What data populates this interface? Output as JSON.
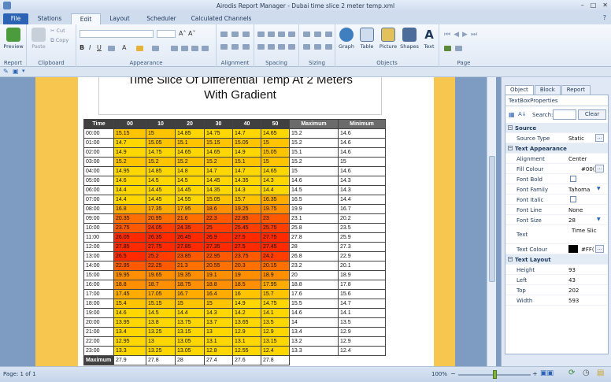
{
  "window": {
    "title": "Airodis Report Manager - Dubai time slice 2 meter temp.xml"
  },
  "menu_tabs": [
    "File",
    "Stations",
    "Edit",
    "Layout",
    "Scheduler",
    "Calculated Channels"
  ],
  "ribbon": {
    "report": {
      "label": "Report",
      "preview": "Preview"
    },
    "clipboard": {
      "label": "Clipboard",
      "paste": "Paste",
      "cut": "Cut",
      "copy": "Copy"
    },
    "appearance": {
      "label": "Appearance"
    },
    "alignment": {
      "label": "Alignment"
    },
    "spacing": {
      "label": "Spacing"
    },
    "sizing": {
      "label": "Sizing"
    },
    "objects": {
      "label": "Objects",
      "graph": "Graph",
      "table": "Table",
      "picture": "Picture",
      "shapes": "Shapes",
      "text": "Text"
    },
    "page": {
      "label": "Page"
    }
  },
  "report": {
    "title_line1": "Time Slice Of Differential Temp At 2 Meters",
    "title_line2": "With Gradient",
    "headers": [
      "Time",
      "00",
      "10",
      "20",
      "30",
      "40",
      "50",
      "Maximum",
      "Minimum"
    ],
    "rows": [
      {
        "t": "00:00",
        "v": [
          "15.15",
          "15",
          "14.85",
          "14.75",
          "14.7",
          "14.65"
        ],
        "max": "15.2",
        "min": "14.6"
      },
      {
        "t": "01:00",
        "v": [
          "14.7",
          "15.05",
          "15.1",
          "15.15",
          "15.05",
          "15"
        ],
        "max": "15.2",
        "min": "14.6"
      },
      {
        "t": "02:00",
        "v": [
          "14.9",
          "14.75",
          "14.65",
          "14.65",
          "14.9",
          "15.05"
        ],
        "max": "15.1",
        "min": "14.6"
      },
      {
        "t": "03:00",
        "v": [
          "15.2",
          "15.2",
          "15.2",
          "15.2",
          "15.1",
          "15"
        ],
        "max": "15.2",
        "min": "15"
      },
      {
        "t": "04:00",
        "v": [
          "14.95",
          "14.85",
          "14.8",
          "14.7",
          "14.7",
          "14.65"
        ],
        "max": "15",
        "min": "14.6"
      },
      {
        "t": "05:00",
        "v": [
          "14.6",
          "14.5",
          "14.5",
          "14.45",
          "14.35",
          "14.3"
        ],
        "max": "14.6",
        "min": "14.3"
      },
      {
        "t": "06:00",
        "v": [
          "14.4",
          "14.45",
          "14.45",
          "14.35",
          "14.3",
          "14.4"
        ],
        "max": "14.5",
        "min": "14.3"
      },
      {
        "t": "07:00",
        "v": [
          "14.4",
          "14.45",
          "14.55",
          "15.05",
          "15.7",
          "16.35"
        ],
        "max": "16.5",
        "min": "14.4"
      },
      {
        "t": "08:00",
        "v": [
          "16.8",
          "17.35",
          "17.95",
          "18.6",
          "19.25",
          "19.75"
        ],
        "max": "19.9",
        "min": "16.7"
      },
      {
        "t": "09:00",
        "v": [
          "20.35",
          "20.95",
          "21.6",
          "22.3",
          "22.85",
          "23"
        ],
        "max": "23.1",
        "min": "20.2"
      },
      {
        "t": "10:00",
        "v": [
          "23.75",
          "24.05",
          "24.35",
          "25",
          "25.45",
          "25.75"
        ],
        "max": "25.8",
        "min": "23.5"
      },
      {
        "t": "11:00",
        "v": [
          "26.05",
          "26.35",
          "26.45",
          "26.9",
          "27.5",
          "27.75"
        ],
        "max": "27.8",
        "min": "25.9"
      },
      {
        "t": "12:00",
        "v": [
          "27.85",
          "27.75",
          "27.85",
          "27.35",
          "27.5",
          "27.45"
        ],
        "max": "28",
        "min": "27.3"
      },
      {
        "t": "13:00",
        "v": [
          "26.5",
          "25.2",
          "23.85",
          "22.95",
          "23.75",
          "24.2"
        ],
        "max": "26.8",
        "min": "22.9"
      },
      {
        "t": "14:00",
        "v": [
          "22.95",
          "22.25",
          "21.3",
          "20.55",
          "20.3",
          "20.15"
        ],
        "max": "23.2",
        "min": "20.1"
      },
      {
        "t": "15:00",
        "v": [
          "19.95",
          "19.65",
          "19.35",
          "19.1",
          "19",
          "18.9"
        ],
        "max": "20",
        "min": "18.9"
      },
      {
        "t": "16:00",
        "v": [
          "18.8",
          "18.7",
          "18.75",
          "18.8",
          "18.5",
          "17.95"
        ],
        "max": "18.8",
        "min": "17.8"
      },
      {
        "t": "17:00",
        "v": [
          "17.45",
          "17.05",
          "16.7",
          "16.4",
          "16",
          "15.7"
        ],
        "max": "17.6",
        "min": "15.6"
      },
      {
        "t": "18:00",
        "v": [
          "15.4",
          "15.15",
          "15",
          "15",
          "14.9",
          "14.75"
        ],
        "max": "15.5",
        "min": "14.7"
      },
      {
        "t": "19:00",
        "v": [
          "14.6",
          "14.5",
          "14.4",
          "14.3",
          "14.2",
          "14.1"
        ],
        "max": "14.6",
        "min": "14.1"
      },
      {
        "t": "20:00",
        "v": [
          "13.95",
          "13.8",
          "13.75",
          "13.7",
          "13.65",
          "13.5"
        ],
        "max": "14",
        "min": "13.5"
      },
      {
        "t": "21:00",
        "v": [
          "13.4",
          "13.25",
          "13.15",
          "13",
          "12.9",
          "12.9"
        ],
        "max": "13.4",
        "min": "12.9"
      },
      {
        "t": "22:00",
        "v": [
          "12.95",
          "13",
          "13.05",
          "13.1",
          "13.1",
          "13.15"
        ],
        "max": "13.2",
        "min": "12.9"
      },
      {
        "t": "23:00",
        "v": [
          "13.3",
          "13.25",
          "13.05",
          "12.8",
          "12.55",
          "12.4"
        ],
        "max": "13.3",
        "min": "12.4"
      }
    ],
    "max_label": "Maximum",
    "max_row": [
      "27.9",
      "27.8",
      "28",
      "27.4",
      "27.6",
      "27.8"
    ]
  },
  "panel": {
    "tabs": [
      "Object",
      "Block",
      "Report"
    ],
    "class_name": "TextBoxProperties",
    "search_label": "Search:",
    "clear": "Clear",
    "sections": {
      "source": "Source",
      "appearance": "Text Appearance",
      "layout": "Text Layout"
    },
    "props": {
      "source_type": {
        "name": "Source Type",
        "value": "Static"
      },
      "alignment": {
        "name": "Alignment",
        "value": "Center"
      },
      "fill_colour": {
        "name": "Fill Colour",
        "value": "#00("
      },
      "font_bold": {
        "name": "Font Bold"
      },
      "font_family": {
        "name": "Font Family",
        "value": "Tahoma"
      },
      "font_italic": {
        "name": "Font Italic"
      },
      "font_line": {
        "name": "Font Line",
        "value": "None"
      },
      "font_size": {
        "name": "Font Size",
        "value": "28"
      },
      "text": {
        "name": "Text",
        "value": "Time Slic"
      },
      "text_colour": {
        "name": "Text Colour",
        "value": "#FF("
      },
      "height": {
        "name": "Height",
        "value": "93"
      },
      "left": {
        "name": "Left",
        "value": "43"
      },
      "top": {
        "name": "Top",
        "value": "202"
      },
      "width": {
        "name": "Width",
        "value": "593"
      }
    }
  },
  "status": {
    "page": "Page: 1 of 1",
    "zoom": "100%"
  },
  "colors": {
    "accent": "#2c63b5",
    "paper": "#f7c64f"
  }
}
